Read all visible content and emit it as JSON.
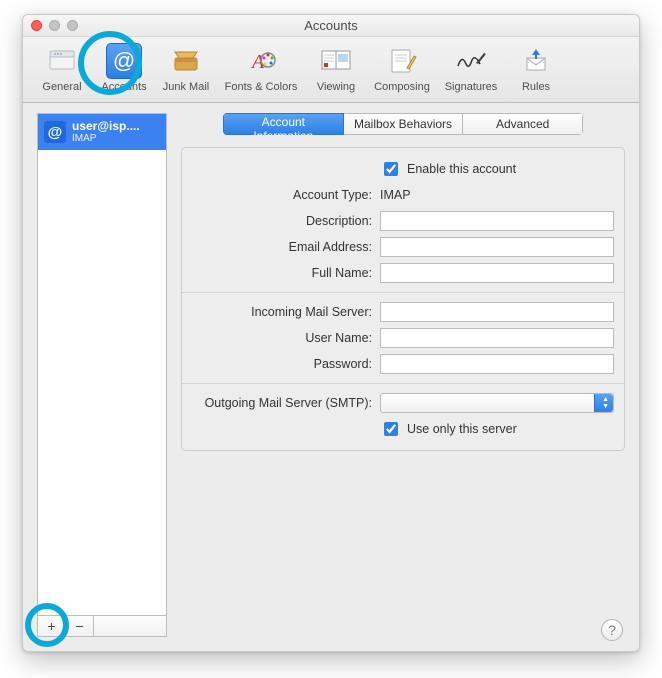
{
  "window": {
    "title": "Accounts"
  },
  "toolbar": {
    "items": [
      {
        "label": "General"
      },
      {
        "label": "Accounts"
      },
      {
        "label": "Junk Mail"
      },
      {
        "label": "Fonts & Colors"
      },
      {
        "label": "Viewing"
      },
      {
        "label": "Composing"
      },
      {
        "label": "Signatures"
      },
      {
        "label": "Rules"
      }
    ]
  },
  "sidebar": {
    "account": {
      "name": "user@isp....",
      "type": "IMAP"
    }
  },
  "tabs": {
    "info": "Account Information",
    "mailbox": "Mailbox Behaviors",
    "advanced": "Advanced"
  },
  "form": {
    "enable_label": "Enable this account",
    "enable_checked": true,
    "account_type_label": "Account Type:",
    "account_type_value": "IMAP",
    "description_label": "Description:",
    "description_value": "",
    "email_label": "Email Address:",
    "email_value": "",
    "fullname_label": "Full Name:",
    "fullname_value": "",
    "incoming_label": "Incoming Mail Server:",
    "incoming_value": "",
    "username_label": "User Name:",
    "username_value": "",
    "password_label": "Password:",
    "password_value": "",
    "smtp_label": "Outgoing Mail Server (SMTP):",
    "smtp_value": "",
    "use_only_label": "Use only this server",
    "use_only_checked": true
  },
  "footer": {
    "add": "+",
    "remove": "−"
  },
  "help": "?"
}
